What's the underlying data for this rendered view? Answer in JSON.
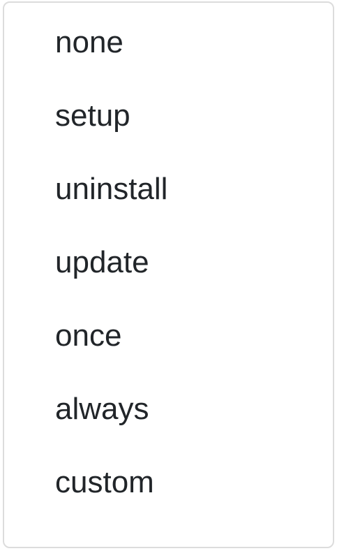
{
  "dropdown": {
    "options": [
      {
        "label": "none"
      },
      {
        "label": "setup"
      },
      {
        "label": "uninstall"
      },
      {
        "label": "update"
      },
      {
        "label": "once"
      },
      {
        "label": "always"
      },
      {
        "label": "custom"
      }
    ]
  }
}
